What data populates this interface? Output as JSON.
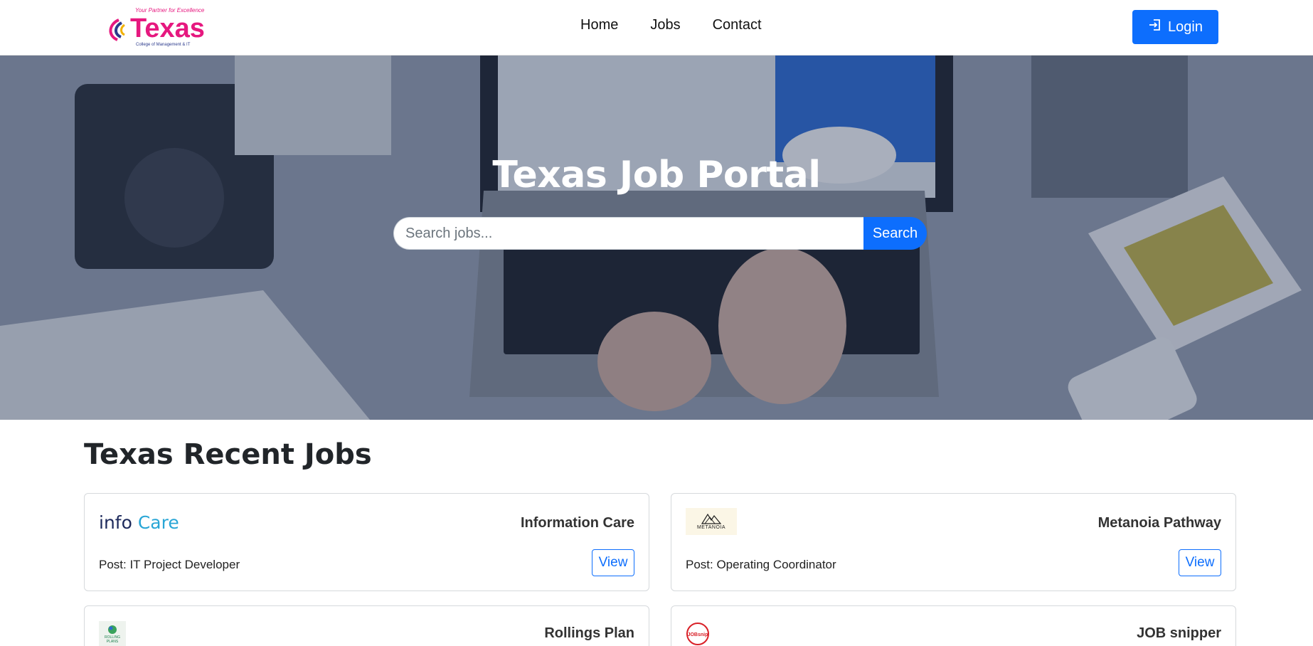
{
  "brand": {
    "tagline": "Your Partner for Excellence",
    "name": "Texas",
    "subtitle": "College of Management & IT"
  },
  "nav": {
    "links": [
      "Home",
      "Jobs",
      "Contact"
    ],
    "login_label": "Login"
  },
  "hero": {
    "title": "Texas Job Portal",
    "search_placeholder": "Search jobs...",
    "search_button": "Search"
  },
  "recent": {
    "title": "Texas Recent Jobs",
    "jobs": [
      {
        "company": "Information Care",
        "logo_text_1": "info",
        "logo_text_2": "Care",
        "post": "Post: IT Project Developer",
        "action": "View"
      },
      {
        "company": "Metanoia Pathway",
        "logo_text": "METANOIA",
        "post": "Post: Operating Coordinator",
        "action": "View"
      },
      {
        "company": "Rollings Plan",
        "logo_text": "ROLLING PLANS"
      },
      {
        "company": "JOB snipper",
        "logo_text": "JOBsnip"
      }
    ]
  },
  "colors": {
    "primary": "#0d6efd",
    "brand_magenta": "#e6187f",
    "brand_navy": "#1d2a5c",
    "infocare_blue": "#29a6d6"
  },
  "icons": {
    "login": "login-icon",
    "logo": "texas-logo"
  }
}
